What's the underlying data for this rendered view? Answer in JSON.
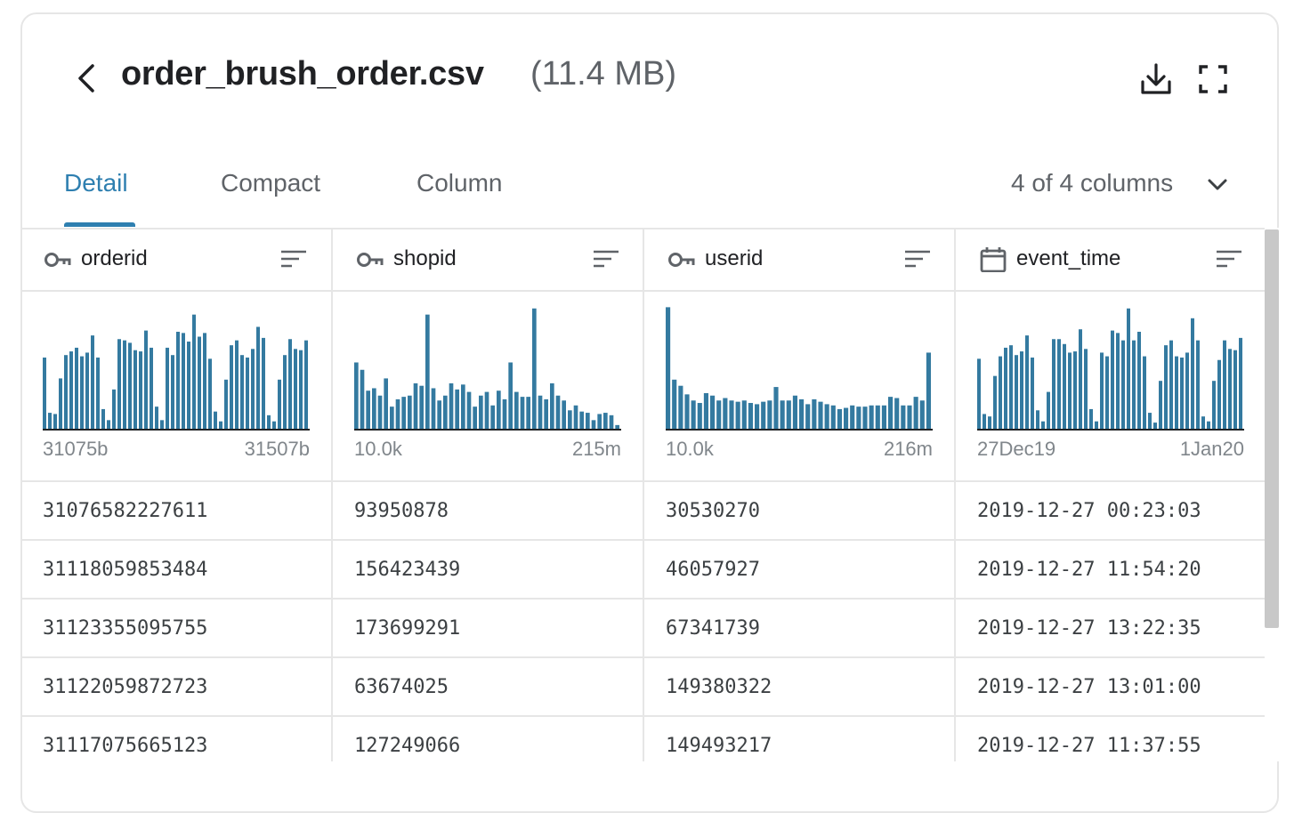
{
  "header": {
    "filename": "order_brush_order.csv",
    "filesize": "(11.4 MB)"
  },
  "icons": {
    "back": "chevron-left-icon",
    "download": "download-icon",
    "fullscreen": "fullscreen-icon"
  },
  "tabs": [
    {
      "label": "Detail",
      "active": true
    },
    {
      "label": "Compact",
      "active": false
    },
    {
      "label": "Column",
      "active": false
    }
  ],
  "column_selector": {
    "label": "4 of 4 columns"
  },
  "accent_color": "#2e7fb0",
  "bar_color": "#347aa0",
  "columns": [
    {
      "name": "orderid",
      "icon": "key-icon",
      "hist": {
        "min_label": "31075b",
        "max_label": "31507b",
        "bins": [
          0.58,
          0.13,
          0.12,
          0.41,
          0.6,
          0.63,
          0.66,
          0.59,
          0.62,
          0.76,
          0.58,
          0.16,
          0.07,
          0.32,
          0.73,
          0.72,
          0.7,
          0.64,
          0.63,
          0.8,
          0.66,
          0.18,
          0.07,
          0.66,
          0.6,
          0.79,
          0.78,
          0.71,
          0.93,
          0.75,
          0.78,
          0.57,
          0.14,
          0.06,
          0.4,
          0.68,
          0.72,
          0.6,
          0.58,
          0.65,
          0.83,
          0.74,
          0.11,
          0.06,
          0.4,
          0.6,
          0.73,
          0.65,
          0.64,
          0.72
        ]
      }
    },
    {
      "name": "shopid",
      "icon": "key-icon",
      "hist": {
        "min_label": "10.0k",
        "max_label": "215m",
        "bins": [
          0.54,
          0.48,
          0.31,
          0.33,
          0.27,
          0.41,
          0.18,
          0.24,
          0.26,
          0.27,
          0.37,
          0.35,
          0.93,
          0.33,
          0.23,
          0.27,
          0.37,
          0.32,
          0.36,
          0.3,
          0.18,
          0.27,
          0.3,
          0.19,
          0.31,
          0.24,
          0.54,
          0.3,
          0.26,
          0.26,
          0.98,
          0.27,
          0.24,
          0.37,
          0.27,
          0.23,
          0.15,
          0.19,
          0.14,
          0.13,
          0.07,
          0.12,
          0.13,
          0.11,
          0.03
        ]
      }
    },
    {
      "name": "userid",
      "icon": "key-icon",
      "hist": {
        "min_label": "10.0k",
        "max_label": "216m",
        "bins": [
          0.99,
          0.4,
          0.35,
          0.28,
          0.23,
          0.21,
          0.29,
          0.27,
          0.23,
          0.25,
          0.23,
          0.22,
          0.23,
          0.21,
          0.2,
          0.22,
          0.23,
          0.34,
          0.23,
          0.23,
          0.27,
          0.24,
          0.2,
          0.24,
          0.22,
          0.2,
          0.19,
          0.16,
          0.17,
          0.19,
          0.18,
          0.18,
          0.19,
          0.19,
          0.19,
          0.26,
          0.25,
          0.19,
          0.19,
          0.26,
          0.23,
          0.62
        ]
      }
    },
    {
      "name": "event_time",
      "icon": "calendar-icon",
      "hist": {
        "min_label": "27Dec19",
        "max_label": "1Jan20",
        "bins": [
          0.57,
          0.12,
          0.1,
          0.43,
          0.59,
          0.66,
          0.68,
          0.6,
          0.63,
          0.76,
          0.58,
          0.15,
          0.06,
          0.3,
          0.73,
          0.73,
          0.69,
          0.62,
          0.63,
          0.81,
          0.65,
          0.16,
          0.06,
          0.62,
          0.59,
          0.8,
          0.78,
          0.72,
          0.98,
          0.72,
          0.79,
          0.59,
          0.13,
          0.05,
          0.39,
          0.68,
          0.72,
          0.59,
          0.58,
          0.62,
          0.9,
          0.72,
          0.1,
          0.06,
          0.39,
          0.56,
          0.72,
          0.65,
          0.64,
          0.74
        ]
      }
    }
  ],
  "rows": [
    [
      "31076582227611",
      "93950878",
      "30530270",
      "2019-12-27 00:23:03"
    ],
    [
      "31118059853484",
      "156423439",
      "46057927",
      "2019-12-27 11:54:20"
    ],
    [
      "31123355095755",
      "173699291",
      "67341739",
      "2019-12-27 13:22:35"
    ],
    [
      "31122059872723",
      "63674025",
      "149380322",
      "2019-12-27 13:01:00"
    ],
    [
      "31117075665123",
      "127249066",
      "149493217",
      "2019-12-27 11:37:55"
    ]
  ]
}
